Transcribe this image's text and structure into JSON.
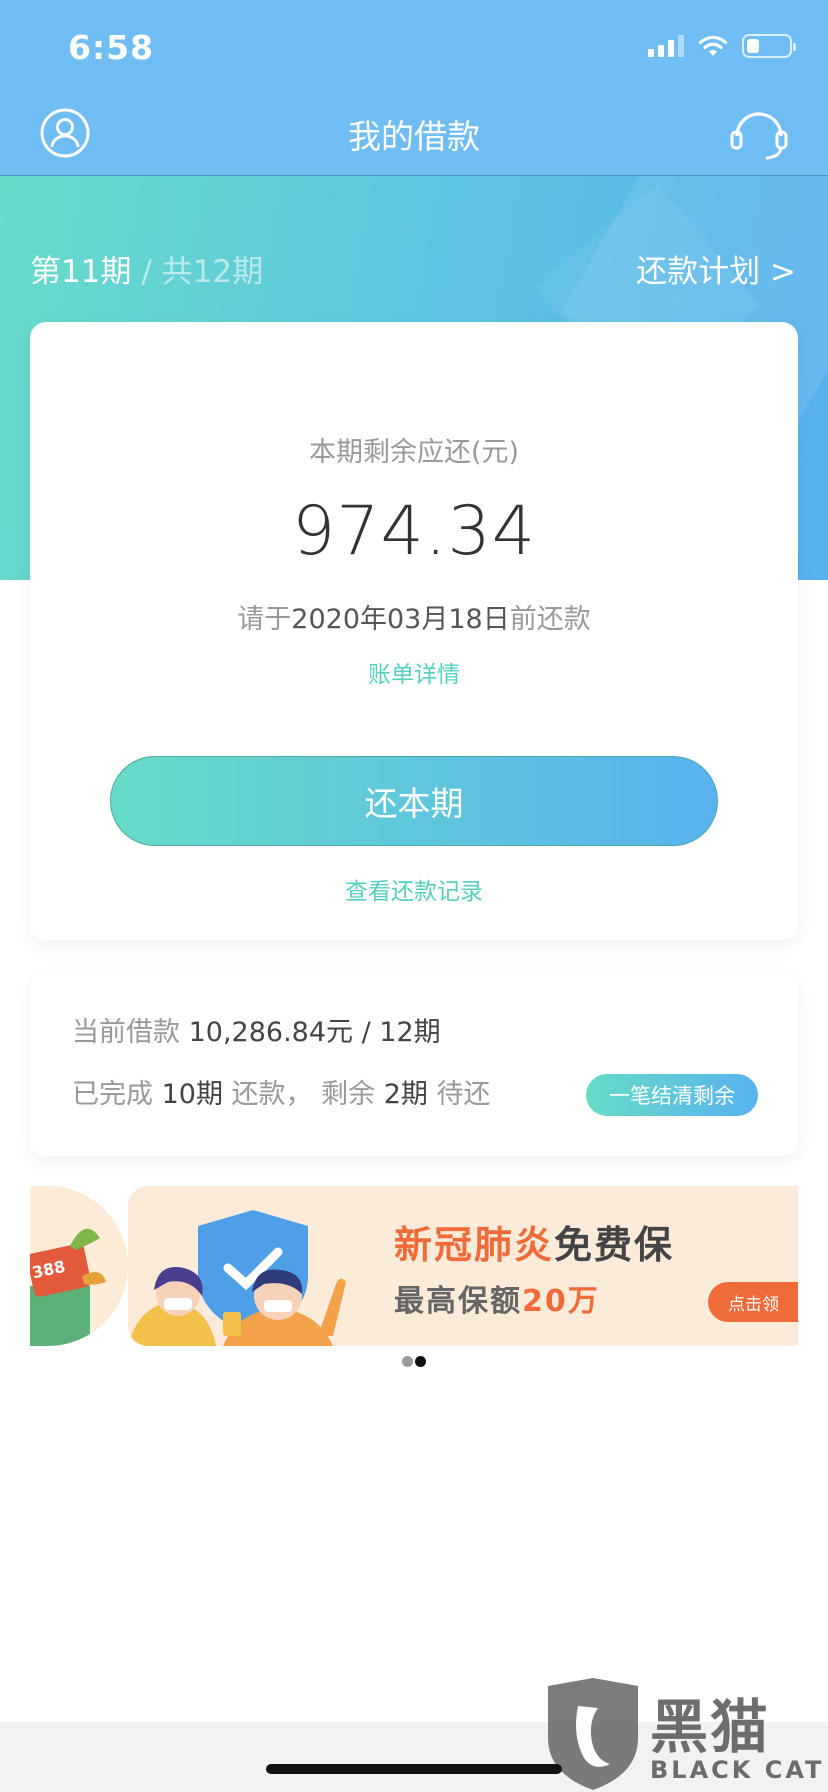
{
  "status_bar": {
    "time": "6:58"
  },
  "nav": {
    "title": "我的借款"
  },
  "period": {
    "current": "第11期",
    "separator": "/",
    "total": "共12期"
  },
  "repay_plan_link": "还款计划 >",
  "bill": {
    "label": "本期剩余应还(元)",
    "amount": "974.34",
    "due_prefix": "请于",
    "due_date": "2020年03月18日",
    "due_suffix": "前还款",
    "detail_link": "账单详情",
    "repay_button": "还本期",
    "record_link": "查看还款记录"
  },
  "loan": {
    "current_label": "当前借款",
    "current_value": "10,286.84元 / 12期",
    "done_label": "已完成",
    "done_value": "10期",
    "done_suffix": "还款，",
    "remain_label": "剩余",
    "remain_value": "2期",
    "remain_suffix": "待还",
    "settle_button": "一笔结清剩余"
  },
  "banner": {
    "title_accent": "新冠肺炎",
    "title_rest": "免费保",
    "sub_prefix": "最高保额",
    "sub_value": "20万",
    "cta": "点击领",
    "side_badge": "388"
  },
  "watermark": {
    "cn": "黑猫",
    "en": "BLACK CAT"
  },
  "colors": {
    "nav": "#6fbdf3",
    "accent": "#55cfc0",
    "gradient_start": "#66dcc7",
    "gradient_end": "#58b2ef",
    "banner_accent": "#ef6b3a"
  }
}
